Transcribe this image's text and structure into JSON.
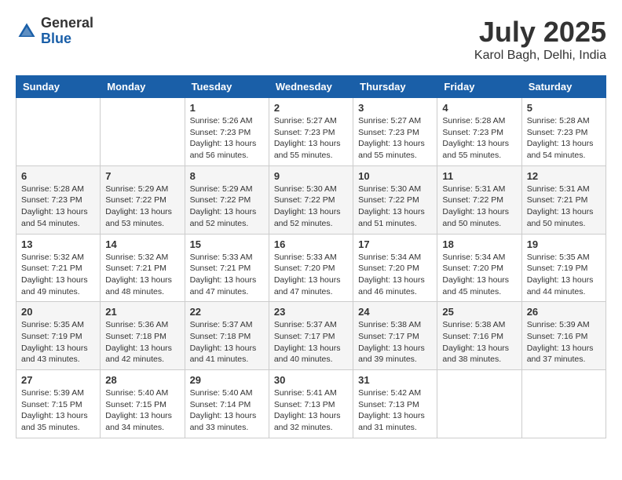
{
  "header": {
    "logo_general": "General",
    "logo_blue": "Blue",
    "month_year": "July 2025",
    "location": "Karol Bagh, Delhi, India"
  },
  "days_of_week": [
    "Sunday",
    "Monday",
    "Tuesday",
    "Wednesday",
    "Thursday",
    "Friday",
    "Saturday"
  ],
  "weeks": [
    [
      {
        "day": "",
        "info": ""
      },
      {
        "day": "",
        "info": ""
      },
      {
        "day": "1",
        "info": "Sunrise: 5:26 AM\nSunset: 7:23 PM\nDaylight: 13 hours and 56 minutes."
      },
      {
        "day": "2",
        "info": "Sunrise: 5:27 AM\nSunset: 7:23 PM\nDaylight: 13 hours and 55 minutes."
      },
      {
        "day": "3",
        "info": "Sunrise: 5:27 AM\nSunset: 7:23 PM\nDaylight: 13 hours and 55 minutes."
      },
      {
        "day": "4",
        "info": "Sunrise: 5:28 AM\nSunset: 7:23 PM\nDaylight: 13 hours and 55 minutes."
      },
      {
        "day": "5",
        "info": "Sunrise: 5:28 AM\nSunset: 7:23 PM\nDaylight: 13 hours and 54 minutes."
      }
    ],
    [
      {
        "day": "6",
        "info": "Sunrise: 5:28 AM\nSunset: 7:23 PM\nDaylight: 13 hours and 54 minutes."
      },
      {
        "day": "7",
        "info": "Sunrise: 5:29 AM\nSunset: 7:22 PM\nDaylight: 13 hours and 53 minutes."
      },
      {
        "day": "8",
        "info": "Sunrise: 5:29 AM\nSunset: 7:22 PM\nDaylight: 13 hours and 52 minutes."
      },
      {
        "day": "9",
        "info": "Sunrise: 5:30 AM\nSunset: 7:22 PM\nDaylight: 13 hours and 52 minutes."
      },
      {
        "day": "10",
        "info": "Sunrise: 5:30 AM\nSunset: 7:22 PM\nDaylight: 13 hours and 51 minutes."
      },
      {
        "day": "11",
        "info": "Sunrise: 5:31 AM\nSunset: 7:22 PM\nDaylight: 13 hours and 50 minutes."
      },
      {
        "day": "12",
        "info": "Sunrise: 5:31 AM\nSunset: 7:21 PM\nDaylight: 13 hours and 50 minutes."
      }
    ],
    [
      {
        "day": "13",
        "info": "Sunrise: 5:32 AM\nSunset: 7:21 PM\nDaylight: 13 hours and 49 minutes."
      },
      {
        "day": "14",
        "info": "Sunrise: 5:32 AM\nSunset: 7:21 PM\nDaylight: 13 hours and 48 minutes."
      },
      {
        "day": "15",
        "info": "Sunrise: 5:33 AM\nSunset: 7:21 PM\nDaylight: 13 hours and 47 minutes."
      },
      {
        "day": "16",
        "info": "Sunrise: 5:33 AM\nSunset: 7:20 PM\nDaylight: 13 hours and 47 minutes."
      },
      {
        "day": "17",
        "info": "Sunrise: 5:34 AM\nSunset: 7:20 PM\nDaylight: 13 hours and 46 minutes."
      },
      {
        "day": "18",
        "info": "Sunrise: 5:34 AM\nSunset: 7:20 PM\nDaylight: 13 hours and 45 minutes."
      },
      {
        "day": "19",
        "info": "Sunrise: 5:35 AM\nSunset: 7:19 PM\nDaylight: 13 hours and 44 minutes."
      }
    ],
    [
      {
        "day": "20",
        "info": "Sunrise: 5:35 AM\nSunset: 7:19 PM\nDaylight: 13 hours and 43 minutes."
      },
      {
        "day": "21",
        "info": "Sunrise: 5:36 AM\nSunset: 7:18 PM\nDaylight: 13 hours and 42 minutes."
      },
      {
        "day": "22",
        "info": "Sunrise: 5:37 AM\nSunset: 7:18 PM\nDaylight: 13 hours and 41 minutes."
      },
      {
        "day": "23",
        "info": "Sunrise: 5:37 AM\nSunset: 7:17 PM\nDaylight: 13 hours and 40 minutes."
      },
      {
        "day": "24",
        "info": "Sunrise: 5:38 AM\nSunset: 7:17 PM\nDaylight: 13 hours and 39 minutes."
      },
      {
        "day": "25",
        "info": "Sunrise: 5:38 AM\nSunset: 7:16 PM\nDaylight: 13 hours and 38 minutes."
      },
      {
        "day": "26",
        "info": "Sunrise: 5:39 AM\nSunset: 7:16 PM\nDaylight: 13 hours and 37 minutes."
      }
    ],
    [
      {
        "day": "27",
        "info": "Sunrise: 5:39 AM\nSunset: 7:15 PM\nDaylight: 13 hours and 35 minutes."
      },
      {
        "day": "28",
        "info": "Sunrise: 5:40 AM\nSunset: 7:15 PM\nDaylight: 13 hours and 34 minutes."
      },
      {
        "day": "29",
        "info": "Sunrise: 5:40 AM\nSunset: 7:14 PM\nDaylight: 13 hours and 33 minutes."
      },
      {
        "day": "30",
        "info": "Sunrise: 5:41 AM\nSunset: 7:13 PM\nDaylight: 13 hours and 32 minutes."
      },
      {
        "day": "31",
        "info": "Sunrise: 5:42 AM\nSunset: 7:13 PM\nDaylight: 13 hours and 31 minutes."
      },
      {
        "day": "",
        "info": ""
      },
      {
        "day": "",
        "info": ""
      }
    ]
  ]
}
